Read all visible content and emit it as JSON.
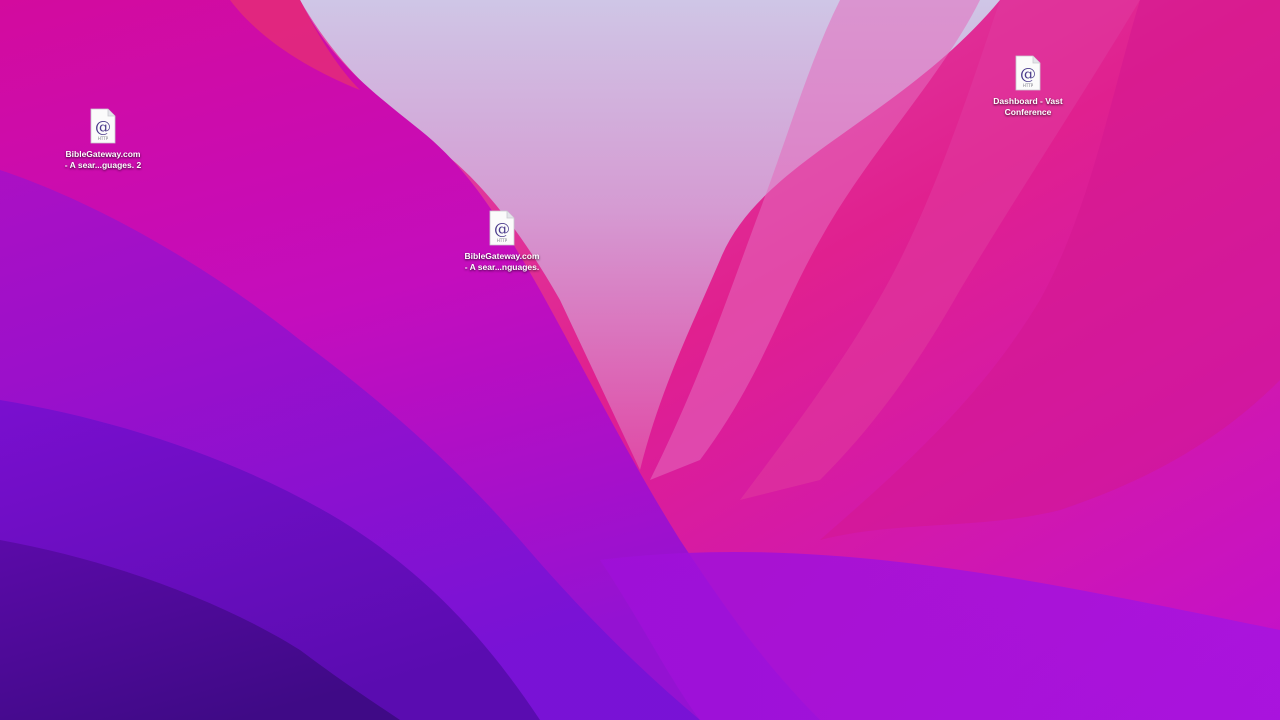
{
  "desktop": {
    "icons": [
      {
        "label_line1": "BibleGateway.com",
        "label_line2": "- A sear...guages. 2",
        "badge": "HTTP",
        "symbol": "@",
        "icon": "webloc-file-icon"
      },
      {
        "label_line1": "BibleGateway.com",
        "label_line2": "- A sear...nguages.",
        "badge": "HTTP",
        "symbol": "@",
        "icon": "webloc-file-icon"
      },
      {
        "label_line1": "Dashboard - Vast",
        "label_line2": "Conference",
        "badge": "HTTP",
        "symbol": "@",
        "icon": "webloc-file-icon"
      }
    ]
  },
  "colors": {
    "wallpaper_deep_purple": "#4a0a9a",
    "wallpaper_violet": "#7a10d8",
    "wallpaper_magenta": "#d4109e",
    "wallpaper_pink": "#e24aa8",
    "wallpaper_lavender": "#d8c6e8",
    "label_text": "#ffffff",
    "icon_symbol": "#4b3c8c"
  }
}
